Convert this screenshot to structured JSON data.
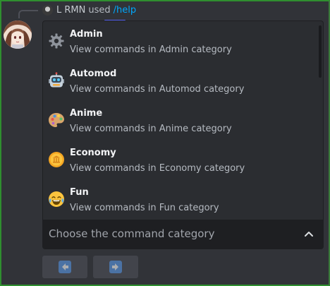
{
  "reply": {
    "username": "L RMN",
    "used_text": "used",
    "command": "/help"
  },
  "dropdown": {
    "placeholder": "Choose the command category",
    "options": [
      {
        "label": "Admin",
        "description": "View commands in Admin category",
        "icon": "gear-icon"
      },
      {
        "label": "Automod",
        "description": "View commands in Automod category",
        "icon": "robot-icon"
      },
      {
        "label": "Anime",
        "description": "View commands in Anime category",
        "icon": "palette-icon"
      },
      {
        "label": "Economy",
        "description": "View commands in Economy category",
        "icon": "coin-icon"
      },
      {
        "label": "Fun",
        "description": "View commands in Fun category",
        "icon": "laughing-emoji-icon"
      }
    ]
  },
  "buttons": {
    "previous": {
      "icon": "arrow-left-icon"
    },
    "next": {
      "icon": "arrow-right-icon"
    }
  },
  "colors": {
    "background": "#313338",
    "dropdown": "#2b2d31",
    "select_bar": "#1e1f22",
    "link": "#00a8fc",
    "frame": "#2f8f2f",
    "accent": "#5865f2"
  }
}
